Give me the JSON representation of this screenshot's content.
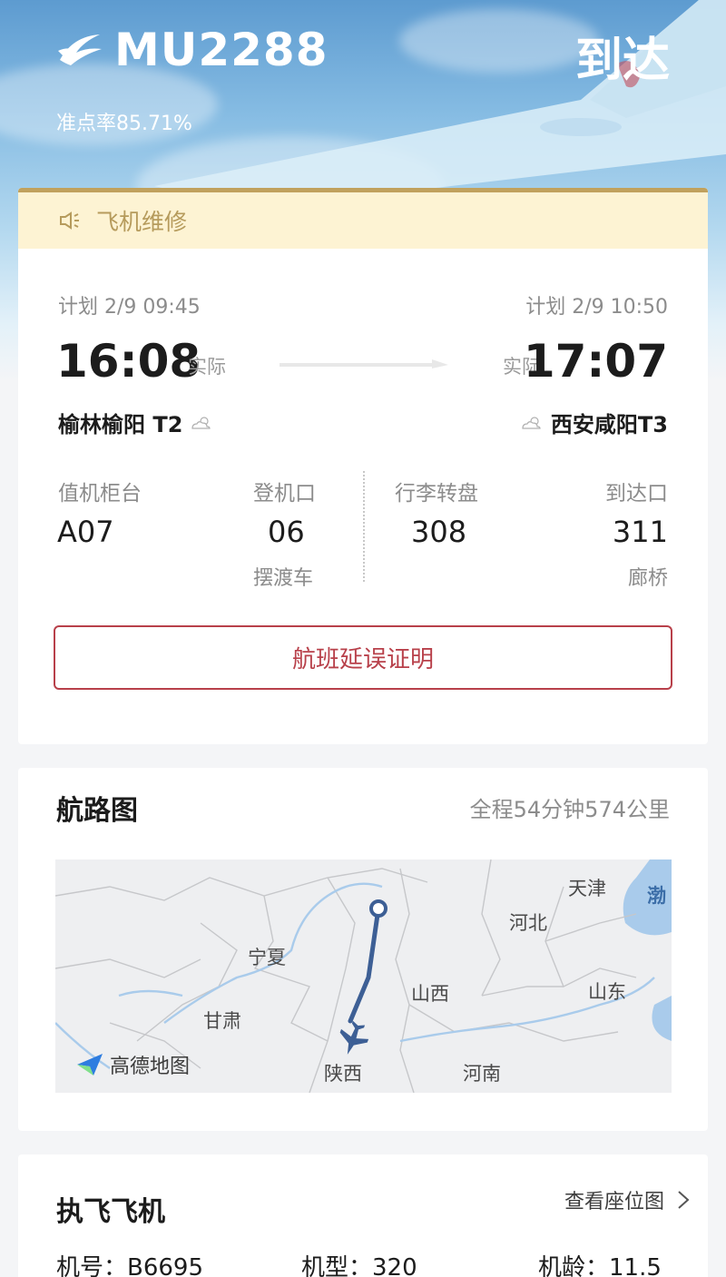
{
  "header": {
    "flight_no": "MU2288",
    "status": "到达",
    "ontime_rate": "准点率85.71%"
  },
  "notice": {
    "text": "飞机维修"
  },
  "schedule": {
    "dep_plan": "计划 2/9 09:45",
    "arr_plan": "计划 2/9 10:50",
    "dep_actual_time": "16:08",
    "arr_actual_time": "17:07",
    "actual_label": "实际",
    "dep_airport": "榆林榆阳 T2",
    "arr_airport": "西安咸阳T3"
  },
  "info": {
    "checkin_label": "值机柜台",
    "checkin_value": "A07",
    "gate_label": "登机口",
    "gate_value": "06",
    "gate_sub": "摆渡车",
    "baggage_label": "行李转盘",
    "baggage_value": "308",
    "exit_label": "到达口",
    "exit_value": "311",
    "exit_sub": "廊桥"
  },
  "delay_button": "航班延误证明",
  "route": {
    "title": "航路图",
    "summary": "全程54分钟574公里",
    "map_labels": [
      "天津",
      "渤",
      "河北",
      "宁夏",
      "山西",
      "山东",
      "甘肃",
      "陕西",
      "河南"
    ],
    "map_brand": "高德地图"
  },
  "aircraft": {
    "title": "执飞飞机",
    "seat_map_link": "查看座位图",
    "reg": "机号：B6695",
    "type": "机型：320",
    "age": "机龄：11.5"
  },
  "colors": {
    "accent_red": "#b8404a",
    "notice_bg": "#fdf3d3",
    "notice_text": "#b69b5c",
    "route_line": "#3d5f95"
  }
}
